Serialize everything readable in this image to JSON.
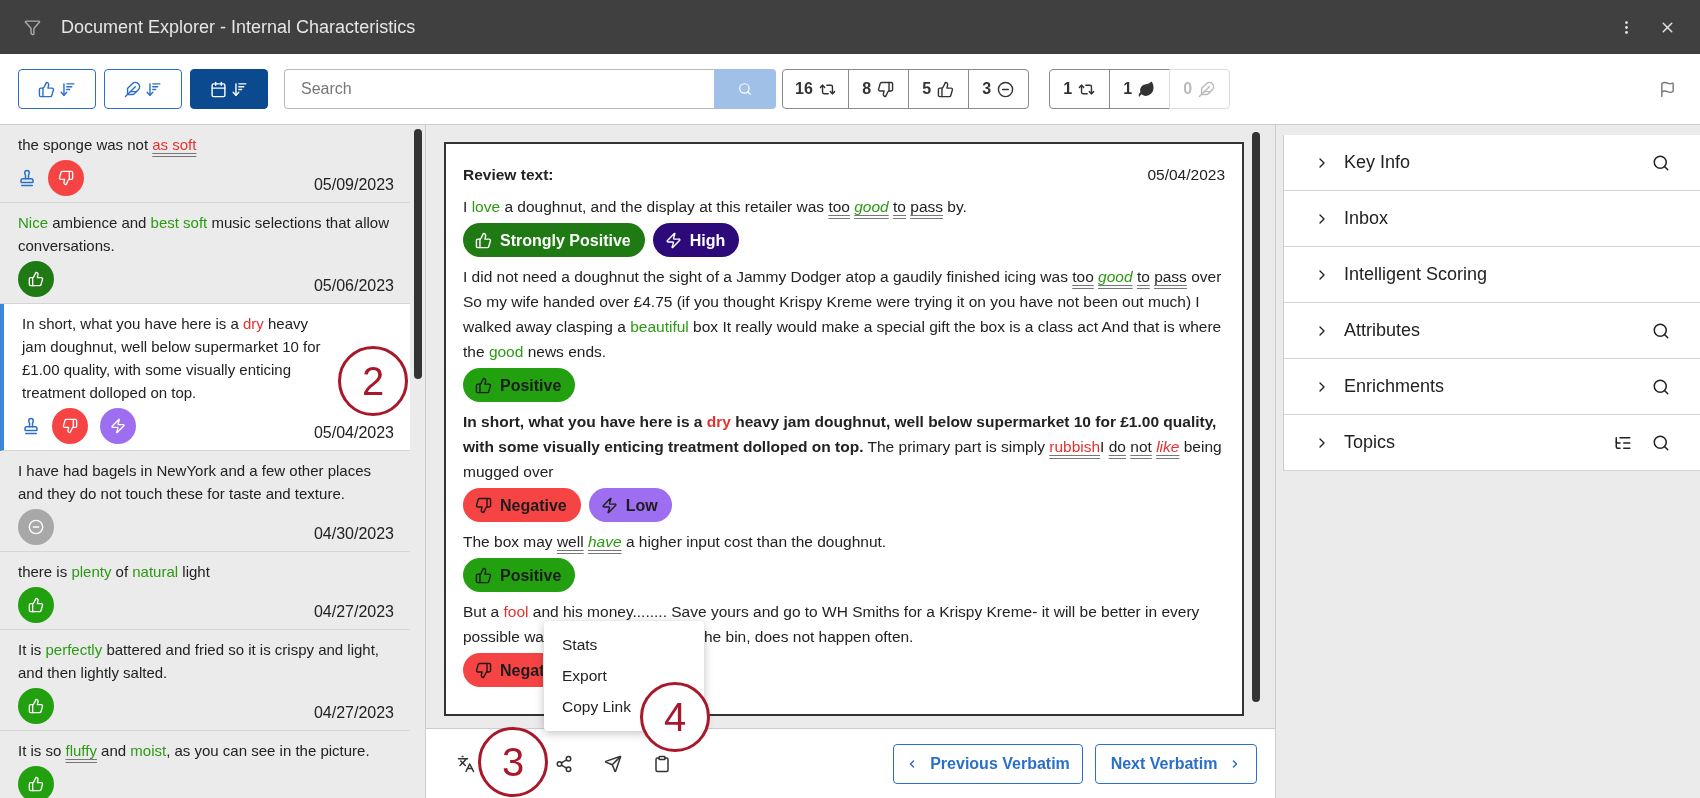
{
  "window": {
    "title": "Document Explorer - Internal Characteristics"
  },
  "toolbar": {
    "sort_buttons": [
      {
        "kind": "sentiment",
        "selected": false
      },
      {
        "kind": "effort",
        "selected": false
      },
      {
        "kind": "date",
        "selected": true
      }
    ],
    "search": {
      "placeholder": "Search"
    },
    "sentiment_counts": [
      {
        "kind": "mixed",
        "count": "16",
        "disabled": false
      },
      {
        "kind": "negative",
        "count": "8",
        "disabled": false
      },
      {
        "kind": "positive",
        "count": "5",
        "disabled": false
      },
      {
        "kind": "neutral",
        "count": "3",
        "disabled": false
      }
    ],
    "effort_counts": [
      {
        "kind": "mixed",
        "count": "1",
        "disabled": false
      },
      {
        "kind": "leaf",
        "count": "1",
        "disabled": false
      },
      {
        "kind": "effort",
        "count": "0",
        "disabled": true
      }
    ]
  },
  "verbatims": [
    {
      "selected": false,
      "date": "05/09/2023",
      "segments": [
        {
          "text": "the sponge was not "
        },
        {
          "text": "as soft",
          "color": "#e8302f",
          "underline": true
        }
      ],
      "tags": [
        {
          "kind": "stamp"
        },
        {
          "kind": "negative"
        }
      ]
    },
    {
      "selected": false,
      "date": "05/06/2023",
      "segments": [
        {
          "text": "Nice ",
          "color": "#2b9a12"
        },
        {
          "text": "ambience and "
        },
        {
          "text": "best soft ",
          "color": "#2b9a12"
        },
        {
          "text": "music selections that allow conversations."
        }
      ],
      "tags": [
        {
          "kind": "strong_positive"
        }
      ]
    },
    {
      "selected": true,
      "date": "05/04/2023",
      "segments": [
        {
          "text": "In short, what you have here is a "
        },
        {
          "text": "dry ",
          "color": "#e8302f"
        },
        {
          "text": "heavy jam doughnut, well below supermarket 10 for £1.00 quality, with some visually enticing treatment dolloped on top."
        }
      ],
      "tags": [
        {
          "kind": "stamp"
        },
        {
          "kind": "negative"
        },
        {
          "kind": "low_effort"
        }
      ]
    },
    {
      "selected": false,
      "date": "04/30/2023",
      "segments": [
        {
          "text": "I have had bagels in NewYork and a few other places and they do not touch these for taste and texture."
        }
      ],
      "tags": [
        {
          "kind": "neutral"
        }
      ]
    },
    {
      "selected": false,
      "date": "04/27/2023",
      "segments": [
        {
          "text": "there is "
        },
        {
          "text": "plenty ",
          "color": "#2b9a12"
        },
        {
          "text": "of "
        },
        {
          "text": "natural ",
          "color": "#2b9a12"
        },
        {
          "text": "light"
        }
      ],
      "tags": [
        {
          "kind": "positive"
        }
      ]
    },
    {
      "selected": false,
      "date": "04/27/2023",
      "segments": [
        {
          "text": "It is "
        },
        {
          "text": "perfectly ",
          "color": "#2b9a12"
        },
        {
          "text": "battered and fried so it is crispy and light, and then lightly salted."
        }
      ],
      "tags": [
        {
          "kind": "positive"
        }
      ]
    },
    {
      "selected": false,
      "segments": [
        {
          "text": "It is so "
        },
        {
          "text": "fluffy ",
          "color": "#2b9a12",
          "underline": true
        },
        {
          "text": "and "
        },
        {
          "text": "moist",
          "color": "#2b9a12"
        },
        {
          "text": ", as you can see in the picture."
        }
      ],
      "tags": [
        {
          "kind": "positive"
        }
      ]
    }
  ],
  "review": {
    "heading": "Review text:",
    "date": "05/04/2023",
    "sentences": [
      {
        "segments": [
          {
            "text": "I "
          },
          {
            "text": "love ",
            "color": "#2b9a12"
          },
          {
            "text": "a doughnut, and the display at this retailer was "
          },
          {
            "text": "too ",
            "underline": true
          },
          {
            "text": "good ",
            "color": "#2b9a12",
            "italic": true,
            "underline": true
          },
          {
            "text": "to ",
            "underline": true
          },
          {
            "text": "pass ",
            "underline": true
          },
          {
            "text": "by."
          }
        ],
        "badges": [
          {
            "kind": "strong_positive",
            "label": "Strongly Positive",
            "covered": false
          },
          {
            "kind": "high_effort",
            "label": "High",
            "covered": false
          }
        ]
      },
      {
        "segments": [
          {
            "text": "I did not need a doughnut the sight of a Jammy Dodger atop a gaudily finished icing was "
          },
          {
            "text": "too ",
            "underline": true
          },
          {
            "text": "good ",
            "color": "#2b9a12",
            "italic": true,
            "underline": true
          },
          {
            "text": "to ",
            "underline": true
          },
          {
            "text": "pass ",
            "underline": true
          },
          {
            "text": "over So my wife handed over £4.75 (if you thought Krispy Kreme were trying it on you have not been out much) I walked away clasping a "
          },
          {
            "text": "beautiful ",
            "color": "#2b9a12"
          },
          {
            "text": "box It really would make a special gift the box is a class act And that is where the "
          },
          {
            "text": "good ",
            "color": "#2b9a12"
          },
          {
            "text": "news ends."
          }
        ],
        "badges": [
          {
            "kind": "positive",
            "label": "Positive",
            "covered": false
          }
        ]
      },
      {
        "segments": [
          {
            "text": "In short, what you have here is a ",
            "bold": true
          },
          {
            "text": "dry ",
            "color": "#e8302f",
            "bold": true
          },
          {
            "text": "heavy jam doughnut, well below supermarket 10 for £1.00 quality, with some visually enticing treatment dolloped on top. ",
            "bold": true
          },
          {
            "text": "The primary part is simply "
          },
          {
            "text": "rubbish",
            "color": "#e8302f",
            "underline": true
          },
          {
            "text": "I "
          },
          {
            "text": "do ",
            "underline": true
          },
          {
            "text": "not ",
            "underline": true
          },
          {
            "text": "like ",
            "color": "#e8302f",
            "italic": true,
            "underline": true
          },
          {
            "text": "being mugged over"
          }
        ],
        "badges": [
          {
            "kind": "negative",
            "label": "Negative",
            "covered": false
          },
          {
            "kind": "low_effort",
            "label": "Low",
            "covered": false
          }
        ]
      },
      {
        "segments": [
          {
            "text": "The box may "
          },
          {
            "text": "well ",
            "underline": true
          },
          {
            "text": "have ",
            "color": "#2b9a12",
            "italic": true,
            "underline": true
          },
          {
            "text": "a higher input cost than the doughnut."
          }
        ],
        "badges": [
          {
            "kind": "positive",
            "label": "Positive",
            "covered": false
          }
        ]
      },
      {
        "segments": [
          {
            "text": "But a "
          },
          {
            "text": "fool ",
            "color": "#e8302f"
          },
          {
            "text": "and his money........ Save yours and go to WH Smiths for a Krispy Kreme- it will be better in every"
          }
        ],
        "line_2": "possible wa",
        "continuation": "he bin, does not happen often.",
        "badges": [
          {
            "kind": "negative",
            "label": "Negat",
            "covered": true
          }
        ]
      }
    ]
  },
  "context_menu": {
    "items": [
      {
        "label": "Stats"
      },
      {
        "label": "Export"
      },
      {
        "label": "Copy Link"
      }
    ]
  },
  "footer": {
    "tools": [
      {
        "kind": "translate"
      },
      {
        "kind": "share"
      },
      {
        "kind": "send"
      },
      {
        "kind": "clipboard"
      }
    ],
    "previous": "Previous Verbatim",
    "next": "Next Verbatim"
  },
  "sections": [
    {
      "label": "Key Info",
      "expanded": false,
      "actions": [
        {
          "kind": "search"
        }
      ]
    },
    {
      "label": "Inbox",
      "expanded": false
    },
    {
      "label": "Intelligent Scoring",
      "expanded": false
    },
    {
      "label": "Attributes",
      "expanded": false,
      "actions": [
        {
          "kind": "search"
        }
      ]
    },
    {
      "label": "Enrichments",
      "expanded": false,
      "actions": [
        {
          "kind": "search"
        }
      ]
    },
    {
      "label": "Topics",
      "expanded": false,
      "actions": [
        {
          "kind": "tree"
        },
        {
          "kind": "search"
        }
      ]
    }
  ],
  "callouts": [
    {
      "label": "2"
    },
    {
      "label": "3"
    },
    {
      "label": "4"
    }
  ]
}
